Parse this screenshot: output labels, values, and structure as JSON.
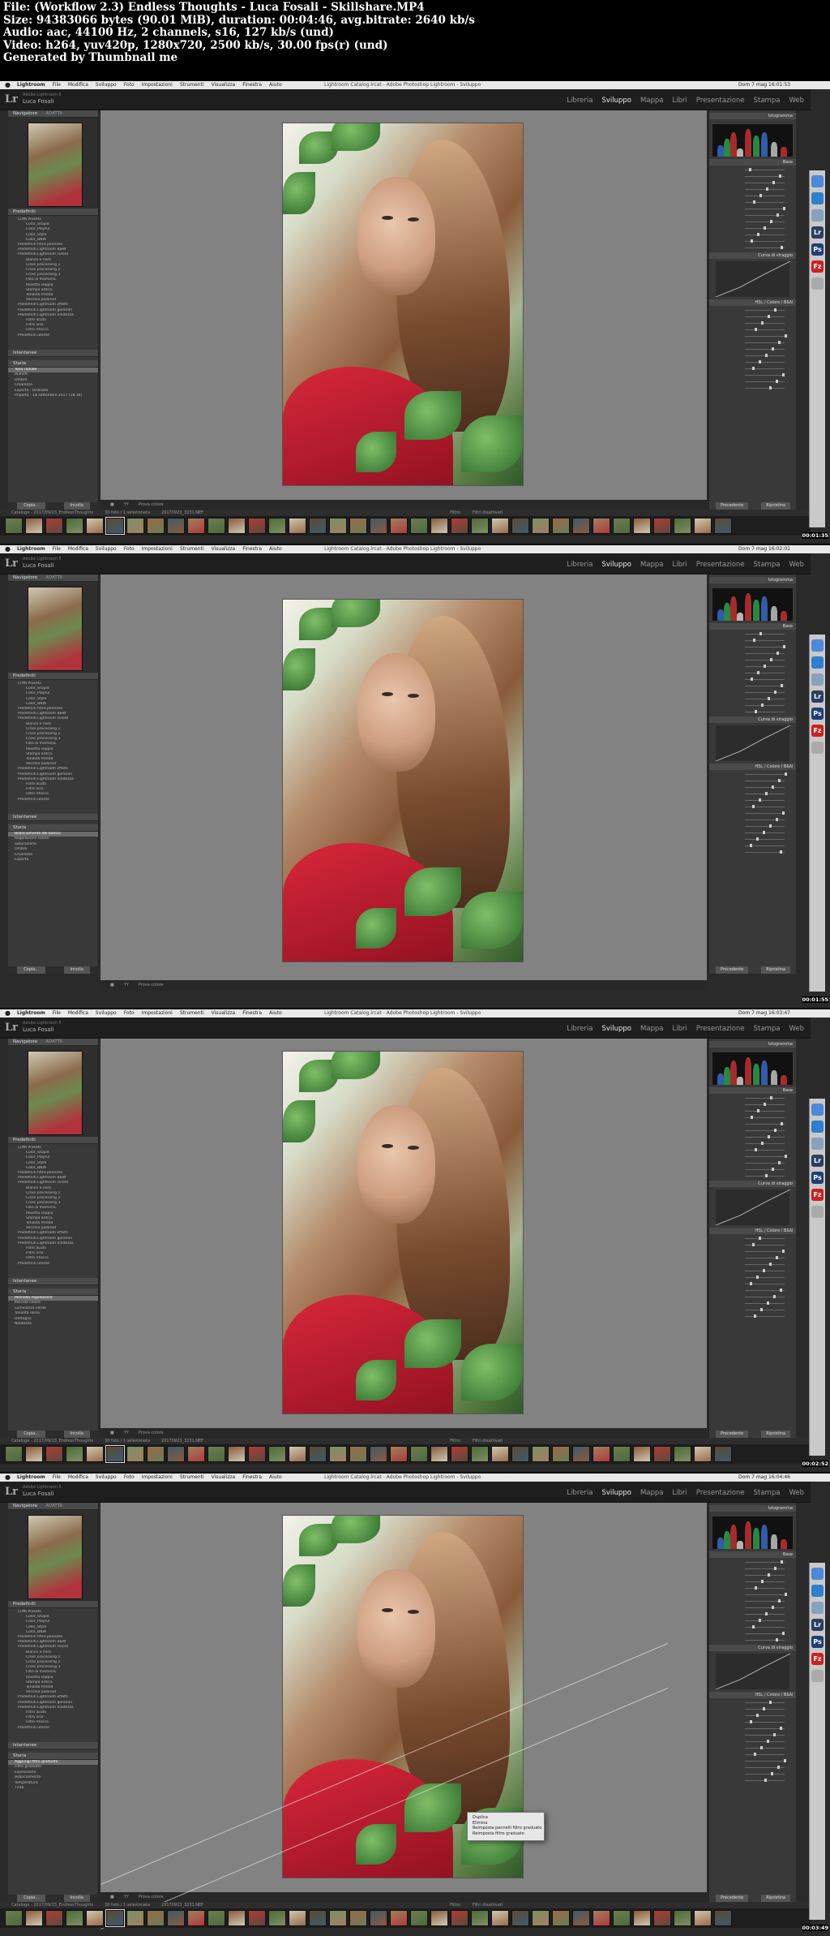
{
  "info": [
    "File: (Workflow 2.3) Endless Thoughts - Luca Fosali - Skillshare.MP4",
    "Size: 94383066 bytes (90.01 MiB), duration: 00:04:46, avg.bitrate: 2640 kb/s",
    "Audio: aac, 44100 Hz, 2 channels, s16, 127 kb/s (und)",
    "Video: h264, yuv420p, 1280x720, 2500 kb/s, 30.00 fps(r) (und)",
    "Generated by Thumbnail me"
  ],
  "menubar": {
    "app": "Lightroom",
    "items": [
      "File",
      "Modifica",
      "Sviluppo",
      "Foto",
      "Impostazioni",
      "Strumenti",
      "Visualizza",
      "Finestra",
      "Aiuto"
    ],
    "window_title": "Lightroom Catalog.lrcat - Adobe Photoshop Lightroom - Sviluppo"
  },
  "identity": {
    "logo": "Lr",
    "version": "Adobe Lightroom 5",
    "user": "Luca Fosali"
  },
  "modules": [
    "Libreria",
    "Sviluppo",
    "Mappa",
    "Libri",
    "Presentazione",
    "Stampa",
    "Web"
  ],
  "navigator": {
    "label": "Navigatore",
    "zoom": "ADATTA"
  },
  "left_panels": {
    "presets": "Predefiniti",
    "snapshots": "Istantanee",
    "history": "Storia"
  },
  "presets": [
    {
      "label": "Lr.Mt.Presets",
      "level": 0
    },
    {
      "label": "Color_Stupid",
      "level": 1
    },
    {
      "label": "Color_Playful",
      "level": 1
    },
    {
      "label": "Color_Style",
      "level": 1
    },
    {
      "label": "Color_BNW",
      "level": 1
    },
    {
      "label": "Predefiniti filtro pennello",
      "level": 0
    },
    {
      "label": "Predefiniti Lightroom B&W",
      "level": 0
    },
    {
      "label": "Predefiniti Lightroom colore",
      "level": 0
    },
    {
      "label": "Bianco e nero",
      "level": 1
    },
    {
      "label": "Cross processing 1",
      "level": 1
    },
    {
      "label": "Cross processing 2",
      "level": 1
    },
    {
      "label": "Cross processing 3",
      "level": 1
    },
    {
      "label": "Foto di memoria",
      "level": 1
    },
    {
      "label": "Rosetta seppia",
      "level": 1
    },
    {
      "label": "Stampa antica",
      "level": 1
    },
    {
      "label": "Tonalità fredda",
      "level": 1
    },
    {
      "label": "Vecchia polaroid",
      "level": 1
    },
    {
      "label": "Predefiniti Lightroom effetti",
      "level": 0
    },
    {
      "label": "Predefiniti Lightroom generali",
      "level": 0
    },
    {
      "label": "Predefiniti Lightroom nitidezza",
      "level": 0
    },
    {
      "label": "Filtro acuto",
      "level": 1
    },
    {
      "label": "Filtro viso",
      "level": 1
    },
    {
      "label": "Filtro ritocco",
      "level": 1
    },
    {
      "label": "Predefiniti utente",
      "level": 0
    }
  ],
  "history_lists": [
    [
      "Tono radiale",
      "Bianchi",
      "Ombre",
      "Chiarezza",
      "Esporta - Ordinato",
      "Importa - 18 settembre 2017 (18:18)"
    ],
    [
      "Bilanciamento del bianco",
      "Regolazione colore",
      "Saturazione",
      "Ombre",
      "Chiarezza",
      "Esporta"
    ],
    [
      "Pennello regolazione",
      "Miscela colore",
      "Luminanza verde",
      "Tonalità rossa",
      "Dettaglio",
      "Nitidezza"
    ],
    [
      "Aggiungi filtro graduato",
      "Filtro graduato",
      "Esposizione",
      "Bilanciamento",
      "Temperatura",
      "Tinta"
    ]
  ],
  "left_buttons": {
    "copy": "Copia...",
    "paste": "Incolla"
  },
  "right_buttons": {
    "previous": "Precedente",
    "reset": "Ripristina"
  },
  "right_panel": {
    "histogram": "Istogramma",
    "basic": "Base",
    "tone_curve": "Curva di viraggio",
    "hsl": "HSL / Colore / B&N"
  },
  "center_toolbar": {
    "soft_proof": "Prova colore"
  },
  "film_header": {
    "catalog": "Catalogo - 2017/09/23_EndlessThoughts",
    "count": "30 foto / 1 selezionata",
    "file": "20170923_3231.NEF",
    "filter_label": "Filtro:",
    "filter_value": "Filtri disattivati"
  },
  "context_menu": [
    "Duplica",
    "Elimina",
    "Reimposta pennelli filtro graduato",
    "Reimposta filtro graduato"
  ],
  "timestamps": [
    "00:01:35",
    "00:01:55",
    "00:02:52",
    "00:03:49"
  ],
  "clocks": [
    "Dom 7 mag 16:01:53",
    "Dom 7 mag 16:02:01",
    "Dom 7 mag 16:03:47",
    "Dom 7 mag 16:04:46"
  ],
  "dock_icons": [
    "finder-icon",
    "safari-icon",
    "mail-icon",
    "lightroom-icon",
    "photoshop-icon",
    "ftp-icon"
  ],
  "colors": {
    "accent": "#dd3333",
    "panel": "#393939",
    "canvas": "#828282"
  }
}
